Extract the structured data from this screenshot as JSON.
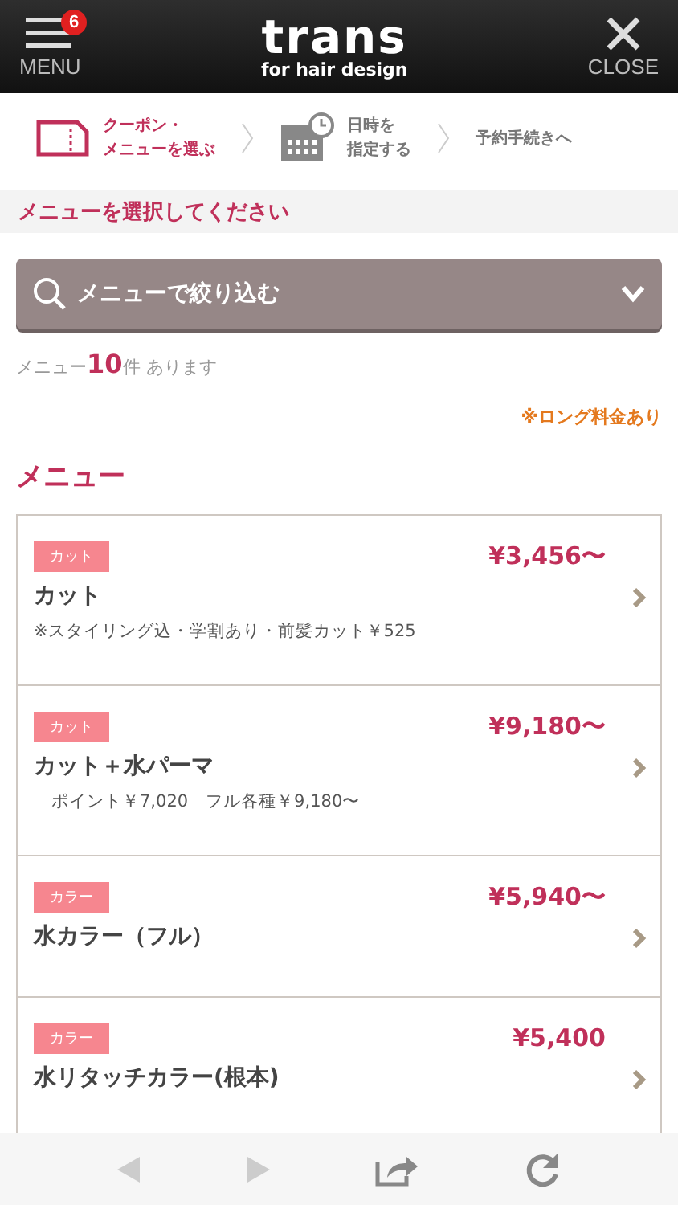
{
  "header": {
    "menu_label": "MENU",
    "menu_badge": "6",
    "logo_title": "trans",
    "logo_subtitle": "for hair design",
    "close_label": "CLOSE"
  },
  "steps": [
    {
      "kind": "coupon",
      "lines": [
        "クーポン・",
        "メニューを選ぶ"
      ],
      "selected": true
    },
    {
      "kind": "calendar",
      "lines": [
        "日時を",
        "指定する"
      ],
      "selected": false
    },
    {
      "kind": "plain",
      "lines": [
        "予約手続きへ"
      ],
      "selected": false
    }
  ],
  "section_title": "メニューを選択してください",
  "filter": {
    "label": "メニューで絞り込む",
    "expanded": false
  },
  "count": {
    "prefix": "メニュー",
    "number": "10",
    "suffix": "件 あります"
  },
  "long_note": "※ロング料金あり",
  "menu_heading": "メニュー",
  "items": [
    {
      "tag": "カット",
      "name": "カット",
      "note": "※スタイリング込・学割あり・前髪カット￥525",
      "price": "¥3,456〜"
    },
    {
      "tag": "カット",
      "name": "カット＋水パーマ",
      "note": "　ポイント￥7,020　フル各種￥9,180〜",
      "price": "¥9,180〜"
    },
    {
      "tag": "カラー",
      "name": "水カラー（フル）",
      "price": "¥5,940〜"
    },
    {
      "tag": "カラー",
      "name": "水リタッチカラー(根本)",
      "price": "¥5,400"
    }
  ],
  "toolbar": [
    {
      "kind": "back",
      "disabled": true
    },
    {
      "kind": "forward",
      "disabled": true
    },
    {
      "kind": "share",
      "disabled": false
    },
    {
      "kind": "reload",
      "disabled": false
    }
  ]
}
